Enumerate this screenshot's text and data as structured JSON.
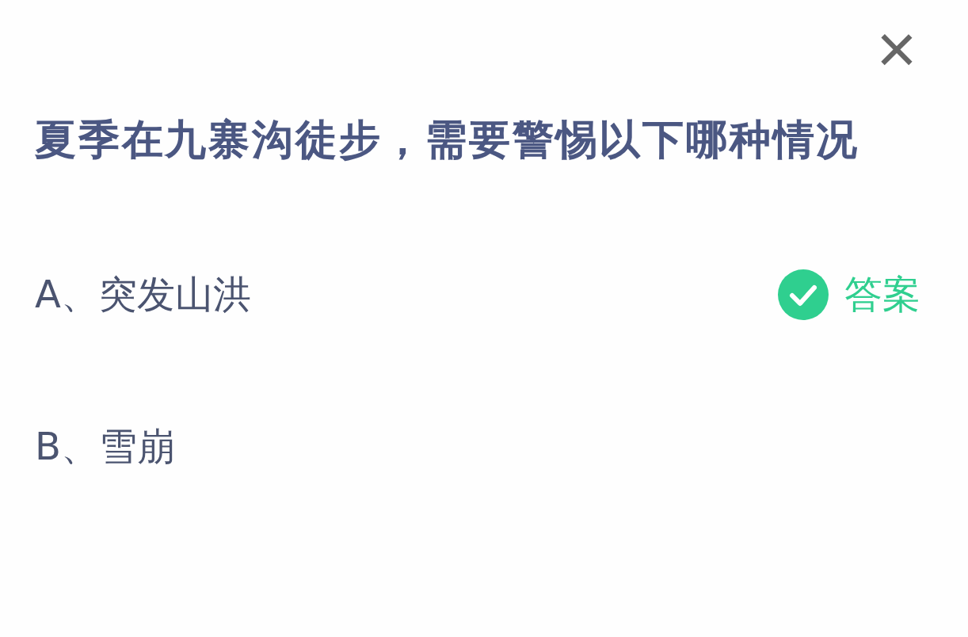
{
  "close": "×",
  "question": "夏季在九寨沟徒步，需要警惕以下哪种情况",
  "answer_text": "答案",
  "options": [
    {
      "label": "A、突发山洪",
      "answer": true
    },
    {
      "label": "B、雪崩",
      "answer": false
    }
  ]
}
